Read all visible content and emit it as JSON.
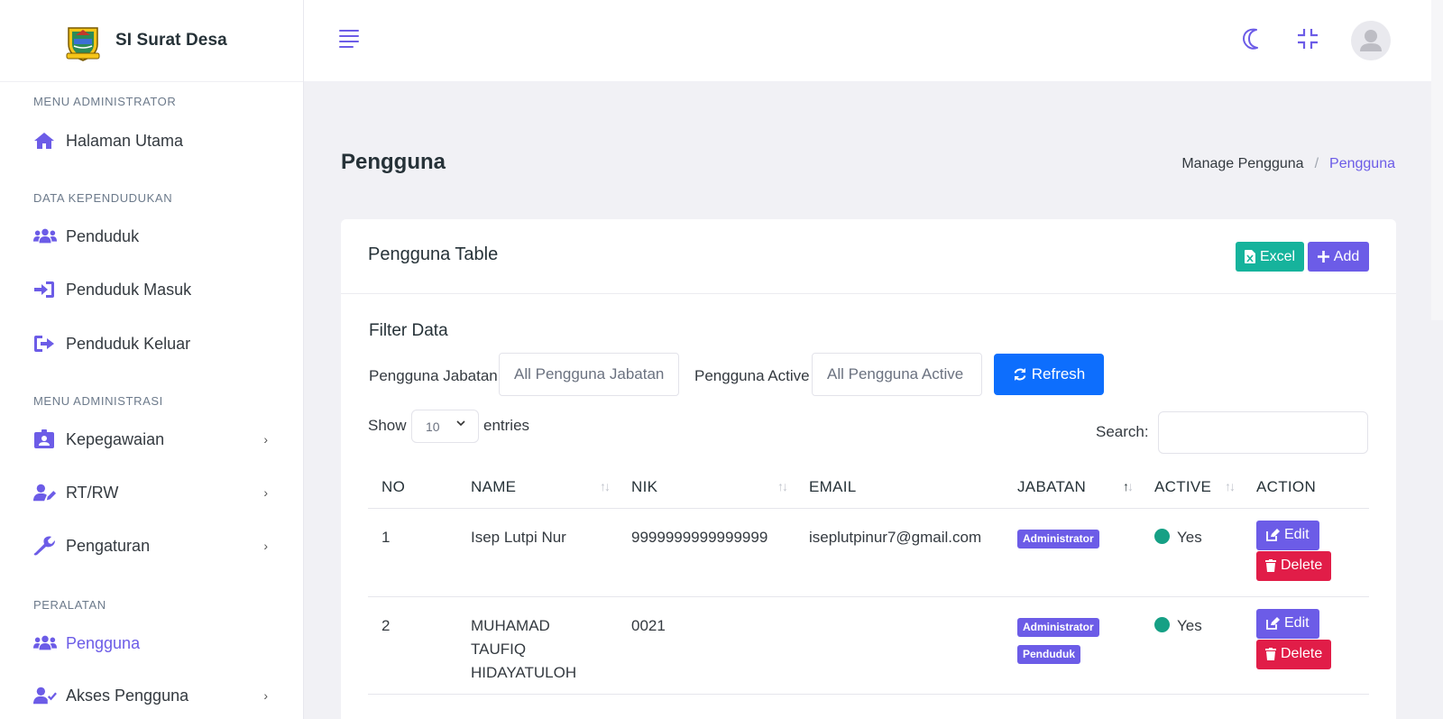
{
  "brand": {
    "name": "SI Surat Desa"
  },
  "sidebar": {
    "sections": [
      "MENU ADMINISTRATOR",
      "DATA KEPENDUDUKAN",
      "MENU ADMINISTRASI",
      "PERALATAN"
    ],
    "items": [
      {
        "label": "Halaman Utama",
        "icon": "home-icon"
      },
      {
        "label": "Penduduk",
        "icon": "users-icon"
      },
      {
        "label": "Penduduk Masuk",
        "icon": "sign-in-icon"
      },
      {
        "label": "Penduduk Keluar",
        "icon": "sign-out-icon"
      },
      {
        "label": "Kepegawaian",
        "icon": "id-badge-icon"
      },
      {
        "label": "RT/RW",
        "icon": "user-edit-icon"
      },
      {
        "label": "Pengaturan",
        "icon": "wrench-icon"
      },
      {
        "label": "Pengguna",
        "icon": "users-icon",
        "active": true
      },
      {
        "label": "Akses Pengguna",
        "icon": "user-check-icon"
      }
    ],
    "chevron": "›"
  },
  "page": {
    "title": "Pengguna",
    "breadcrumb": [
      "Manage Pengguna",
      "/",
      "Pengguna"
    ]
  },
  "card": {
    "title": "Pengguna Table",
    "excel_label": "Excel",
    "add_label": "Add",
    "filter_title": "Filter Data",
    "filter_jabatan_label": "Pengguna Jabatan",
    "filter_jabatan_value": "All Pengguna Jabatan",
    "filter_active_label": "Pengguna Active",
    "filter_active_value": "All Pengguna Active",
    "refresh_label": "Refresh",
    "show_label": "Show",
    "entries_value": "10",
    "entries_label": "entries",
    "search_label": "Search:"
  },
  "table": {
    "headers": [
      "NO",
      "NAME",
      "NIK",
      "EMAIL",
      "JABATAN",
      "ACTIVE",
      "ACTION"
    ],
    "rows": [
      {
        "no": "1",
        "name": "Isep Lutpi Nur",
        "nik": "9999999999999999",
        "email": "iseplutpinur7@gmail.com",
        "jabatan": [
          "Administrator"
        ],
        "active": "Yes"
      },
      {
        "no": "2",
        "name": "MUHAMAD TAUFIQ HIDAYATULOH",
        "nik": "0021",
        "email": "",
        "jabatan": [
          "Administrator",
          "Penduduk"
        ],
        "active": "Yes"
      }
    ],
    "edit_label": "Edit",
    "delete_label": "Delete"
  },
  "colors": {
    "accent": "#6c5ce7",
    "excel": "#16b39c",
    "refresh": "#0d6efd",
    "delete": "#e11d48",
    "active_dot": "#16a085"
  }
}
